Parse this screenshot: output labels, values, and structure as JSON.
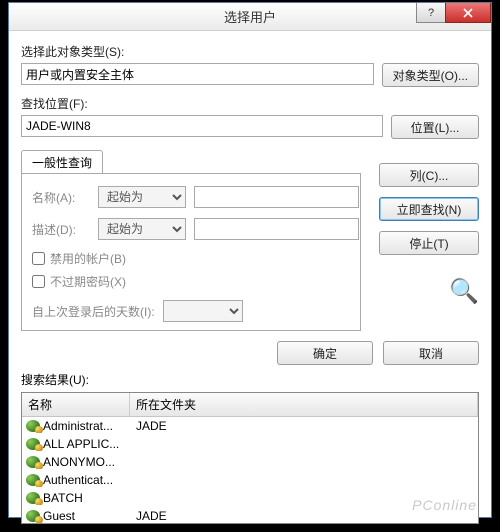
{
  "window": {
    "title": "选择用户"
  },
  "labels": {
    "object_types": "选择此对象类型(S):",
    "look_in": "查找位置(F):",
    "results": "搜索结果(U):"
  },
  "fields": {
    "object_types_value": "用户或内置安全主体",
    "look_in_value": "JADE-WIN8"
  },
  "buttons": {
    "object_types": "对象类型(O)...",
    "locations": "位置(L)...",
    "columns": "列(C)...",
    "find_now": "立即查找(N)",
    "stop": "停止(T)",
    "ok": "确定",
    "cancel": "取消"
  },
  "tab": {
    "common": "一般性查询"
  },
  "query": {
    "name_label": "名称(A):",
    "desc_label": "描述(D):",
    "op_startswith": "起始为",
    "name_value": "",
    "desc_value": "",
    "chk_disabled": "禁用的帐户(B)",
    "chk_pwd_never_expires": "不过期密码(X)",
    "last_login_label": "自上次登录后的天数(I):",
    "last_login_value": ""
  },
  "columns": {
    "name": "名称",
    "folder": "所在文件夹"
  },
  "rows": [
    {
      "name": "Administrat...",
      "folder": "JADE"
    },
    {
      "name": "ALL APPLIC...",
      "folder": ""
    },
    {
      "name": "ANONYMO...",
      "folder": ""
    },
    {
      "name": "Authenticat...",
      "folder": ""
    },
    {
      "name": "BATCH",
      "folder": ""
    },
    {
      "name": "Guest",
      "folder": "JADE"
    }
  ],
  "watermark": "PConline"
}
